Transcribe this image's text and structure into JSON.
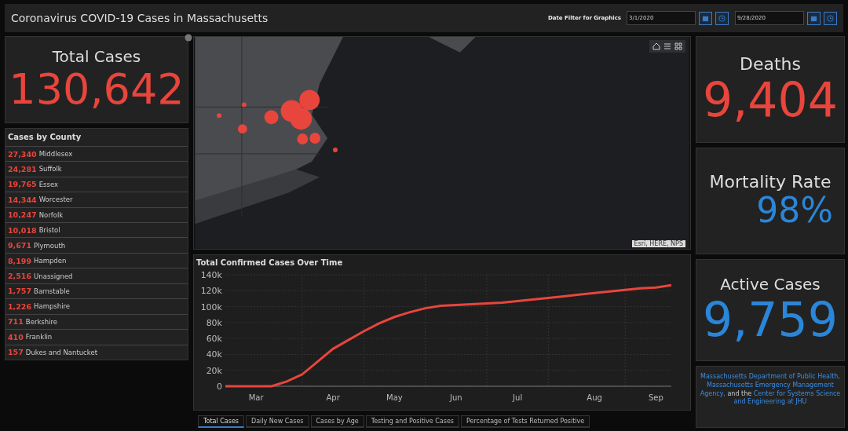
{
  "header": {
    "title": "Coronavirus COVID-19 Cases in Massachusetts",
    "date_filter": {
      "label": "Date Filter for Graphics",
      "start": "3/1/2020",
      "end": "9/28/2020"
    }
  },
  "total_cases": {
    "title": "Total Cases",
    "value": "130,642"
  },
  "county_list": {
    "title": "Cases by County",
    "rows": [
      {
        "count": "27,340",
        "name": "Middlesex"
      },
      {
        "count": "24,281",
        "name": "Suffolk"
      },
      {
        "count": "19,765",
        "name": "Essex"
      },
      {
        "count": "14,344",
        "name": "Worcester"
      },
      {
        "count": "10,247",
        "name": "Norfolk"
      },
      {
        "count": "10,018",
        "name": "Bristol"
      },
      {
        "count": "9,671",
        "name": "Plymouth"
      },
      {
        "count": "8,199",
        "name": "Hampden"
      },
      {
        "count": "2,516",
        "name": "Unassigned"
      },
      {
        "count": "1,757",
        "name": "Barnstable"
      },
      {
        "count": "1,226",
        "name": "Hampshire"
      },
      {
        "count": "711",
        "name": "Berkshire"
      },
      {
        "count": "410",
        "name": "Franklin"
      },
      {
        "count": "157",
        "name": "Dukes and Nantucket"
      }
    ]
  },
  "map": {
    "kind": "picture",
    "attribution": "Esri, HERE, NPS"
  },
  "chart": {
    "title": "Total Confirmed Cases Over Time",
    "chart_data": {
      "type": "line",
      "ylim": [
        0,
        140000
      ],
      "grid": true,
      "categories": [
        null,
        null,
        "Mar",
        null,
        null,
        null,
        null,
        "Apr",
        null,
        null,
        null,
        "May",
        null,
        null,
        null,
        "Jun",
        null,
        null,
        null,
        "Jul",
        null,
        null,
        null,
        null,
        "Aug",
        null,
        null,
        null,
        "Sep",
        null
      ],
      "yticks": [
        {
          "value": 0,
          "label": "0"
        },
        {
          "value": 20000,
          "label": "20k"
        },
        {
          "value": 40000,
          "label": "40k"
        },
        {
          "value": 60000,
          "label": "60k"
        },
        {
          "value": 80000,
          "label": "80k"
        },
        {
          "value": 100000,
          "label": "100k"
        },
        {
          "value": 120000,
          "label": "120k"
        },
        {
          "value": 140000,
          "label": "140k"
        }
      ],
      "series": [
        {
          "color": "#e8453c",
          "values": [
            0,
            0,
            0,
            0,
            6000,
            15000,
            31000,
            47000,
            58000,
            69000,
            79000,
            87000,
            93000,
            98000,
            101000,
            102000,
            103000,
            104000,
            105000,
            107000,
            109000,
            111000,
            113000,
            115000,
            117000,
            119000,
            121000,
            123000,
            124000,
            127000
          ]
        }
      ]
    }
  },
  "chart_tabs": [
    {
      "label": "Total Cases",
      "selected": true
    },
    {
      "label": "Daily New Cases",
      "selected": false
    },
    {
      "label": "Cases by Age",
      "selected": false
    },
    {
      "label": "Testing and Positive Cases",
      "selected": false
    },
    {
      "label": "Percentage of Tests Returned Positive",
      "selected": false
    }
  ],
  "deaths": {
    "title": "Deaths",
    "value": "9,404"
  },
  "mortality": {
    "title": "Mortality Rate",
    "value": "98%"
  },
  "active": {
    "title": "Active Cases",
    "value": "9,759"
  },
  "source": {
    "parts": [
      {
        "text": "Massachusetts Department of Public Health, Massachusetts Emergency Management Agency,",
        "link": true
      },
      {
        "text": " and the ",
        "link": false
      },
      {
        "text": "Center for Systems Science and Engineering at JHU",
        "link": true
      }
    ]
  }
}
